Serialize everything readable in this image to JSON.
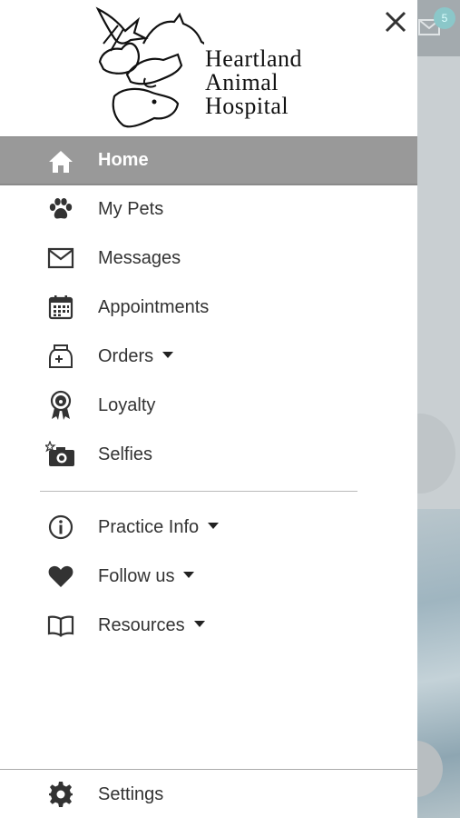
{
  "app": {
    "logo_lines": [
      "Heartland",
      "Animal",
      "Hospital"
    ]
  },
  "background": {
    "badge_count": "5"
  },
  "menu": {
    "items": [
      {
        "label": "Home",
        "icon": "home-icon",
        "active": true
      },
      {
        "label": "My Pets",
        "icon": "paw-icon"
      },
      {
        "label": "Messages",
        "icon": "envelope-icon"
      },
      {
        "label": "Appointments",
        "icon": "calendar-icon"
      },
      {
        "label": "Orders",
        "icon": "food-bag-icon",
        "dropdown": true
      },
      {
        "label": "Loyalty",
        "icon": "award-ribbon-icon"
      },
      {
        "label": "Selfies",
        "icon": "camera-icon"
      }
    ],
    "secondary": [
      {
        "label": "Practice Info",
        "icon": "info-icon",
        "dropdown": true
      },
      {
        "label": "Follow us",
        "icon": "heart-icon",
        "dropdown": true
      },
      {
        "label": "Resources",
        "icon": "book-icon",
        "dropdown": true
      }
    ],
    "settings": {
      "label": "Settings",
      "icon": "gear-icon"
    }
  },
  "colors": {
    "active_background": "#999999",
    "icon": "#333333",
    "divider": "#bbbbbb"
  }
}
